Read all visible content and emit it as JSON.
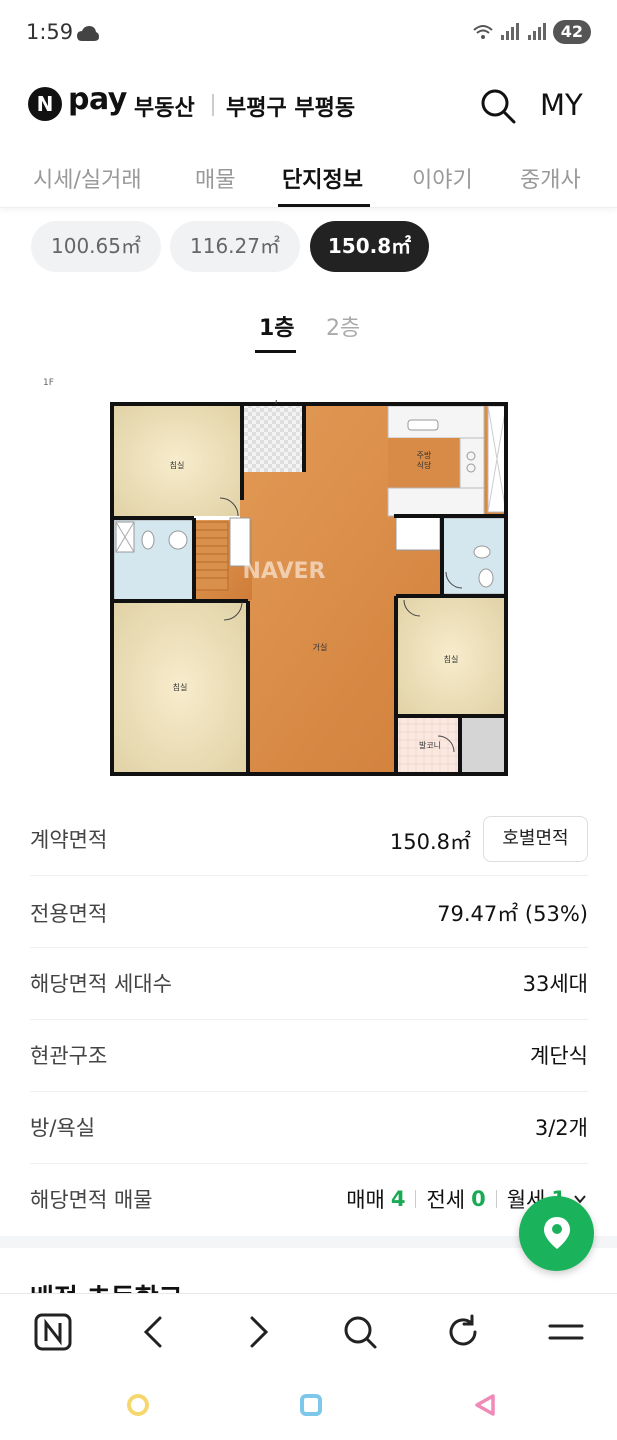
{
  "status": {
    "time": "1:59",
    "battery": "42"
  },
  "header": {
    "logo_n": "N",
    "logo_pay": "pay",
    "service": "부동산",
    "region": "부평구 부평동",
    "my_label": "MY"
  },
  "tabs": [
    {
      "label": "시세/실거래"
    },
    {
      "label": "매물"
    },
    {
      "label": "단지정보"
    },
    {
      "label": "이야기"
    },
    {
      "label": "중개사"
    }
  ],
  "area_chips": [
    {
      "label": "100.65㎡"
    },
    {
      "label": "116.27㎡"
    },
    {
      "label": "150.8㎡"
    }
  ],
  "floor_tabs": [
    {
      "label": "1층"
    },
    {
      "label": "2층"
    }
  ],
  "floorplan": {
    "floor_label": "1F",
    "watermark": "NAVER",
    "rooms": {
      "bedroom_tl": "침실",
      "kitchen": "주방\n식당",
      "living": "거실",
      "bedroom_r": "침실",
      "bedroom_bl": "침실",
      "balcony": "발코니"
    }
  },
  "info": {
    "contract_area": {
      "label": "계약면적",
      "value": "150.8㎡",
      "button": "호별면적"
    },
    "exclusive_area": {
      "label": "전용면적",
      "value": "79.47㎡ (53%)"
    },
    "households": {
      "label": "해당면적 세대수",
      "value": "33세대"
    },
    "entrance": {
      "label": "현관구조",
      "value": "계단식"
    },
    "rooms": {
      "label": "방/욕실",
      "value": "3/2개"
    },
    "listings": {
      "label": "해당면적 매물",
      "sale_label": "매매",
      "sale_count": "4",
      "jeonse_label": "전세",
      "jeonse_count": "0",
      "monthly_label": "월세",
      "monthly_count": "1"
    }
  },
  "next_section_title": "배정 초등학교",
  "colors": {
    "accent_green": "#1ab35c",
    "text_dark": "#111111",
    "chip_active_bg": "#222222"
  },
  "icons": {
    "toolbar": [
      "naver-home-icon",
      "back-icon",
      "forward-icon",
      "search-icon",
      "refresh-icon",
      "menu-icon"
    ],
    "fab": "map-pin-icon"
  }
}
